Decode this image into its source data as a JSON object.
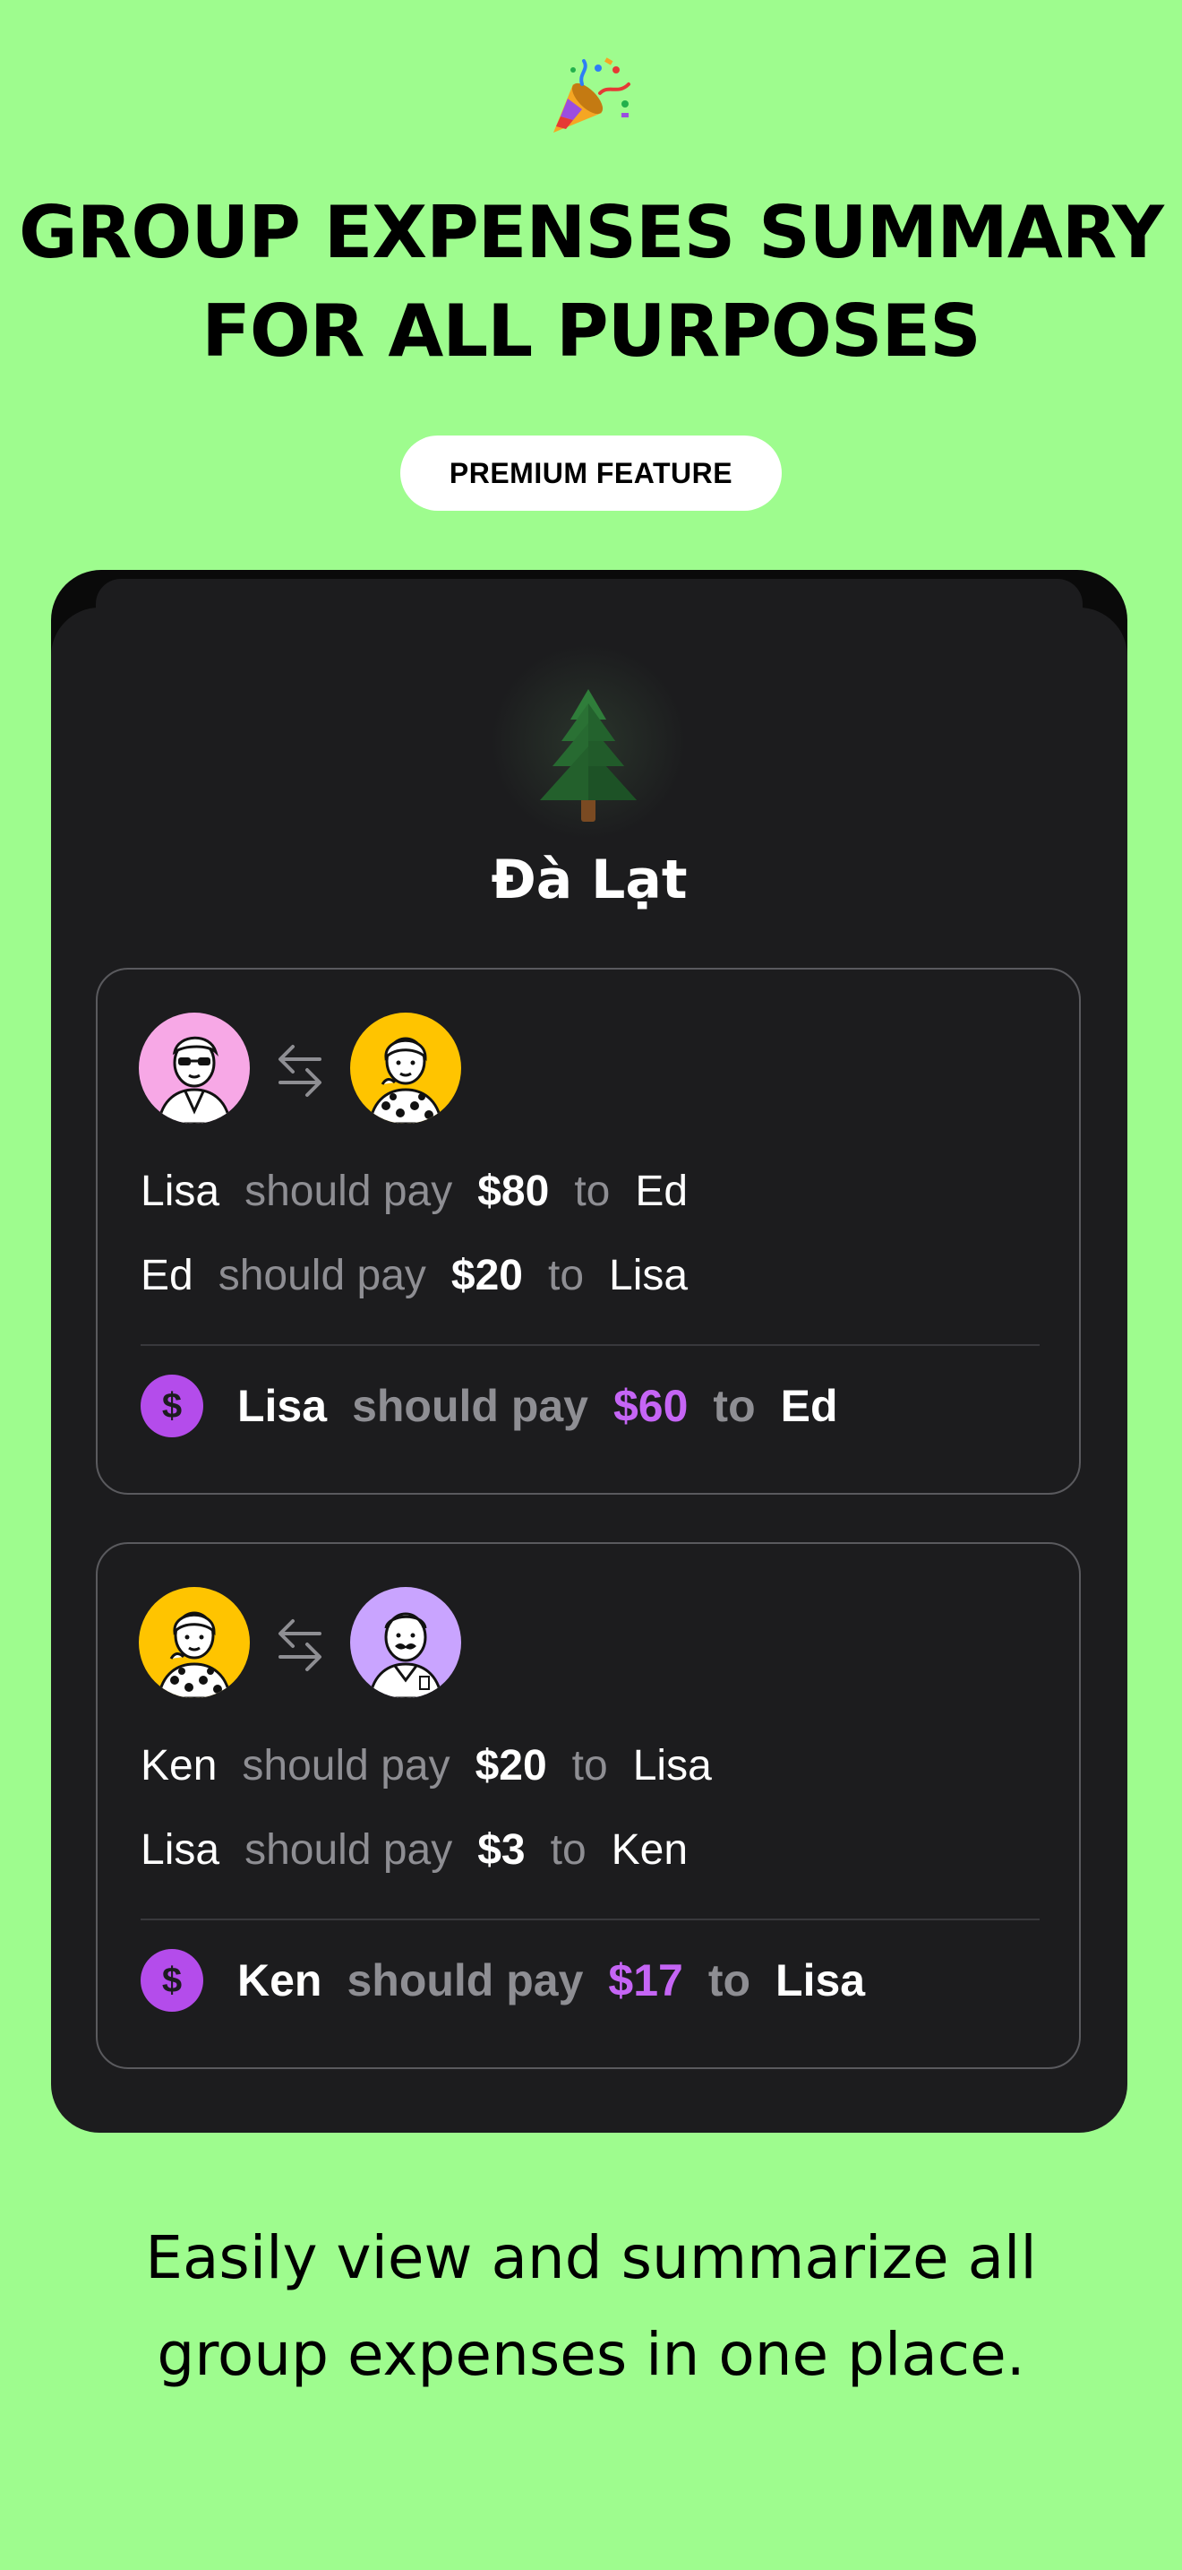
{
  "header": {
    "icon": "party-popper-icon",
    "title_line1": "GROUP EXPENSES SUMMARY",
    "title_line2": "FOR ALL PURPOSES",
    "badge": "PREMIUM FEATURE"
  },
  "group": {
    "icon": "evergreen-tree-icon",
    "name": "Đà Lạt"
  },
  "settlements": [
    {
      "avatars": [
        {
          "name": "avatar-pink-sunglasses",
          "bg": "#F7A8E6"
        },
        {
          "name": "avatar-yellow-polka-dot",
          "bg": "#FFC400"
        }
      ],
      "lines": [
        {
          "from": "Lisa",
          "verb": "should pay",
          "amount": "$80",
          "to_word": "to",
          "to": "Ed"
        },
        {
          "from": "Ed",
          "verb": "should pay",
          "amount": "$20",
          "to_word": "to",
          "to": "Lisa"
        }
      ],
      "total": {
        "from": "Lisa",
        "verb": "should pay",
        "amount": "$60",
        "to_word": "to",
        "to": "Ed"
      }
    },
    {
      "avatars": [
        {
          "name": "avatar-yellow-polka-dot",
          "bg": "#FFC400"
        },
        {
          "name": "avatar-purple-mustache",
          "bg": "#C9A4FF"
        }
      ],
      "lines": [
        {
          "from": "Ken",
          "verb": "should pay",
          "amount": "$20",
          "to_word": "to",
          "to": "Lisa"
        },
        {
          "from": "Lisa",
          "verb": "should pay",
          "amount": "$3",
          "to_word": "to",
          "to": "Ken"
        }
      ],
      "total": {
        "from": "Ken",
        "verb": "should pay",
        "amount": "$17",
        "to_word": "to",
        "to": "Lisa"
      }
    }
  ],
  "coin_symbol": "$",
  "footer": {
    "line1": "Easily view and summarize all",
    "line2": "group expenses in one place."
  },
  "colors": {
    "background": "#9EFC8E",
    "card": "#1C1C1E",
    "accent_purple": "#C565F5"
  }
}
